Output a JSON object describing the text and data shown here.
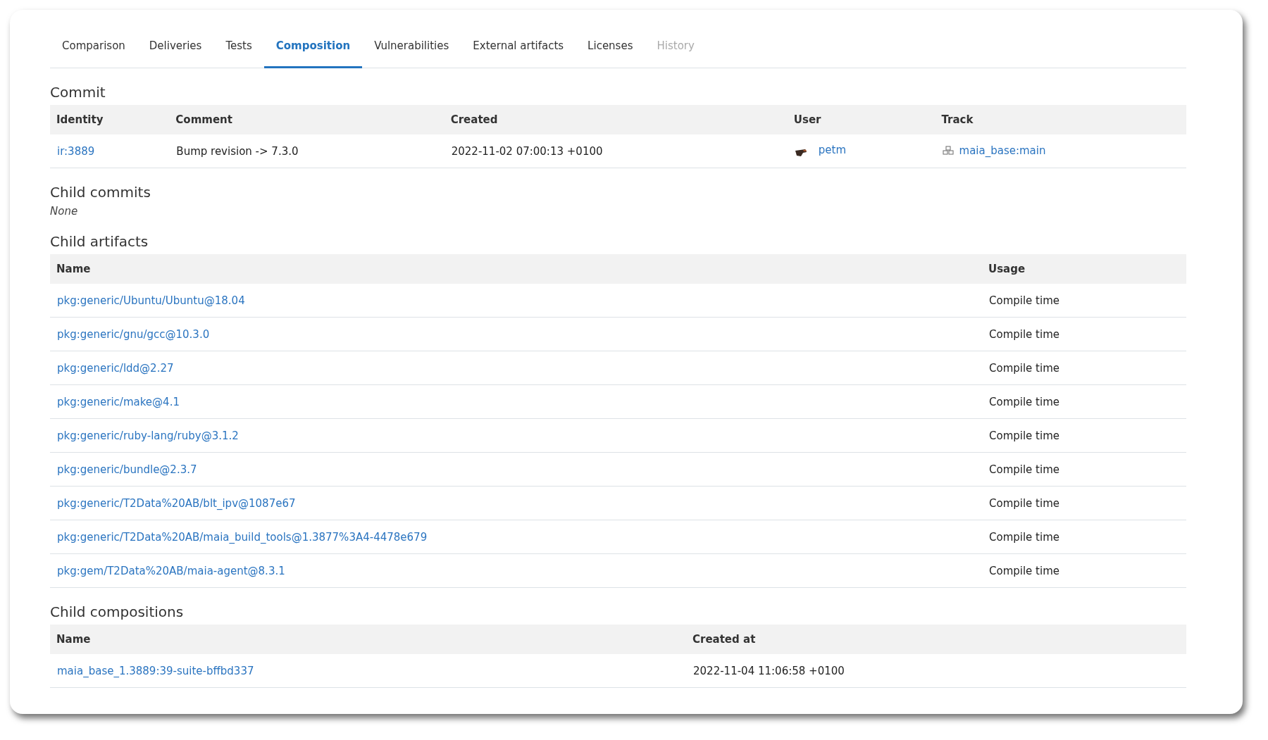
{
  "tabs": [
    {
      "label": "Comparison",
      "selected": false,
      "disabled": false
    },
    {
      "label": "Deliveries",
      "selected": false,
      "disabled": false
    },
    {
      "label": "Tests",
      "selected": false,
      "disabled": false
    },
    {
      "label": "Composition",
      "selected": true,
      "disabled": false
    },
    {
      "label": "Vulnerabilities",
      "selected": false,
      "disabled": false
    },
    {
      "label": "External artifacts",
      "selected": false,
      "disabled": false
    },
    {
      "label": "Licenses",
      "selected": false,
      "disabled": false
    },
    {
      "label": "History",
      "selected": false,
      "disabled": true
    }
  ],
  "commit": {
    "heading": "Commit",
    "columns": [
      "Identity",
      "Comment",
      "Created",
      "User",
      "Track"
    ],
    "row": {
      "identity": "ir:3889",
      "comment": "Bump revision -> 7.3.0",
      "created": "2022-11-02 07:00:13 +0100",
      "user": "petm",
      "track": "maia_base:main"
    }
  },
  "child_commits": {
    "heading": "Child commits",
    "empty_text": "None"
  },
  "child_artifacts": {
    "heading": "Child artifacts",
    "columns": [
      "Name",
      "Usage"
    ],
    "rows": [
      {
        "name": "pkg:generic/Ubuntu/Ubuntu@18.04",
        "usage": "Compile time"
      },
      {
        "name": "pkg:generic/gnu/gcc@10.3.0",
        "usage": "Compile time"
      },
      {
        "name": "pkg:generic/ldd@2.27",
        "usage": "Compile time"
      },
      {
        "name": "pkg:generic/make@4.1",
        "usage": "Compile time"
      },
      {
        "name": "pkg:generic/ruby-lang/ruby@3.1.2",
        "usage": "Compile time"
      },
      {
        "name": "pkg:generic/bundle@2.3.7",
        "usage": "Compile time"
      },
      {
        "name": "pkg:generic/T2Data%20AB/blt_ipv@1087e67",
        "usage": "Compile time"
      },
      {
        "name": "pkg:generic/T2Data%20AB/maia_build_tools@1.3877%3A4-4478e679",
        "usage": "Compile time"
      },
      {
        "name": "pkg:gem/T2Data%20AB/maia-agent@8.3.1",
        "usage": "Compile time"
      }
    ]
  },
  "child_compositions": {
    "heading": "Child compositions",
    "columns": [
      "Name",
      "Created at"
    ],
    "rows": [
      {
        "name": "maia_base_1.3889:39-suite-bffbd337",
        "created_at": "2022-11-04 11:06:58 +0100"
      }
    ]
  }
}
